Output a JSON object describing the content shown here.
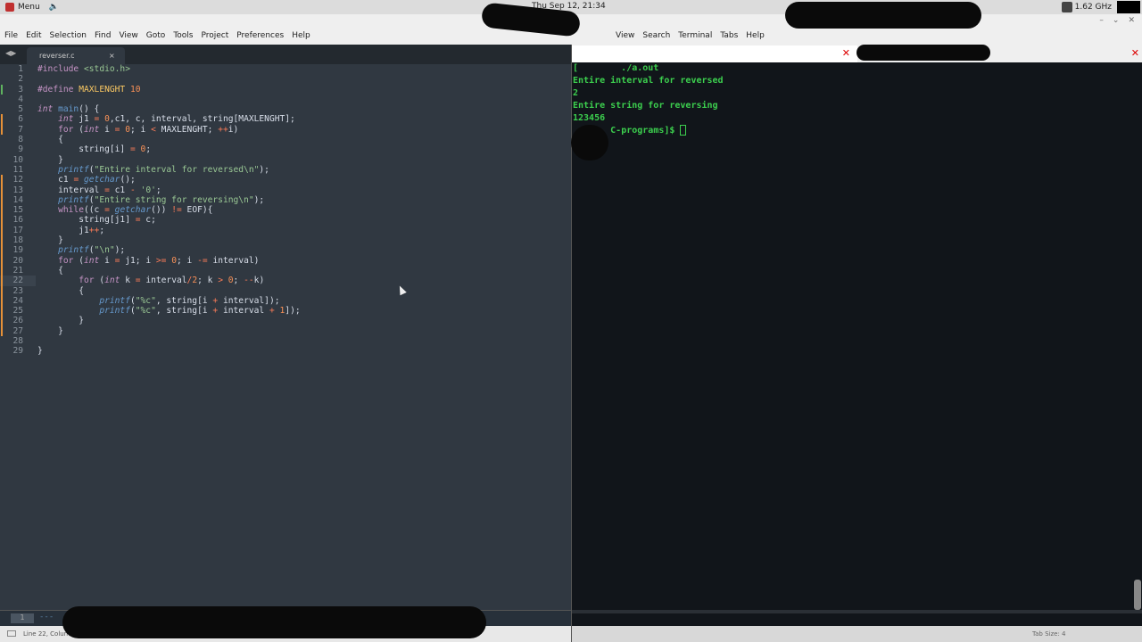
{
  "topbar": {
    "menu_label": "Menu",
    "clock": "Thu Sep 12, 21:34",
    "cpu": "1.62 GHz"
  },
  "editor": {
    "menu": [
      "File",
      "Edit",
      "Selection",
      "Find",
      "View",
      "Goto",
      "Tools",
      "Project",
      "Preferences",
      "Help"
    ],
    "tab_name": "reverser.c",
    "tab_close": "×",
    "status_text": "Line 22, Column 5",
    "mini_line": "1",
    "mini_dashes": "---"
  },
  "terminal": {
    "menu": [
      "View",
      "Search",
      "Terminal",
      "Tabs",
      "Help"
    ],
    "lines": [
      "[        ./a.out",
      "Entire interval for reversed",
      "2",
      "Entire string for reversing",
      "123456"
    ],
    "prompt": "C-programs]$ ",
    "status_right": "Tab Size: 4"
  },
  "code_lines": [
    "#include <stdio.h>",
    "",
    "#define MAXLENGHT 10",
    "",
    "int main() {",
    "    int j1 = 0,c1, c, interval, string[MAXLENGHT];",
    "    for (int i = 0; i < MAXLENGHT; ++i)",
    "    {",
    "        string[i] = 0;",
    "    }",
    "    printf(\"Entire interval for reversed\\n\");",
    "    c1 = getchar();",
    "    interval = c1 - '0';",
    "    printf(\"Entire string for reversing\\n\");",
    "    while((c = getchar()) != EOF){",
    "        string[j1] = c;",
    "        j1++;",
    "    }",
    "    printf(\"\\n\");",
    "    for (int i = j1; i >= 0; i -= interval)",
    "    {",
    "        for (int k = interval/2; k > 0; --k)",
    "        {",
    "            printf(\"%c\", string[i + interval]);",
    "            printf(\"%c\", string[i + interval + 1]);",
    "        }",
    "    }",
    "",
    "}"
  ],
  "colors": {
    "editor_bg": "#303841",
    "terminal_bg": "#11151a",
    "terminal_text": "#3ccf4e"
  }
}
